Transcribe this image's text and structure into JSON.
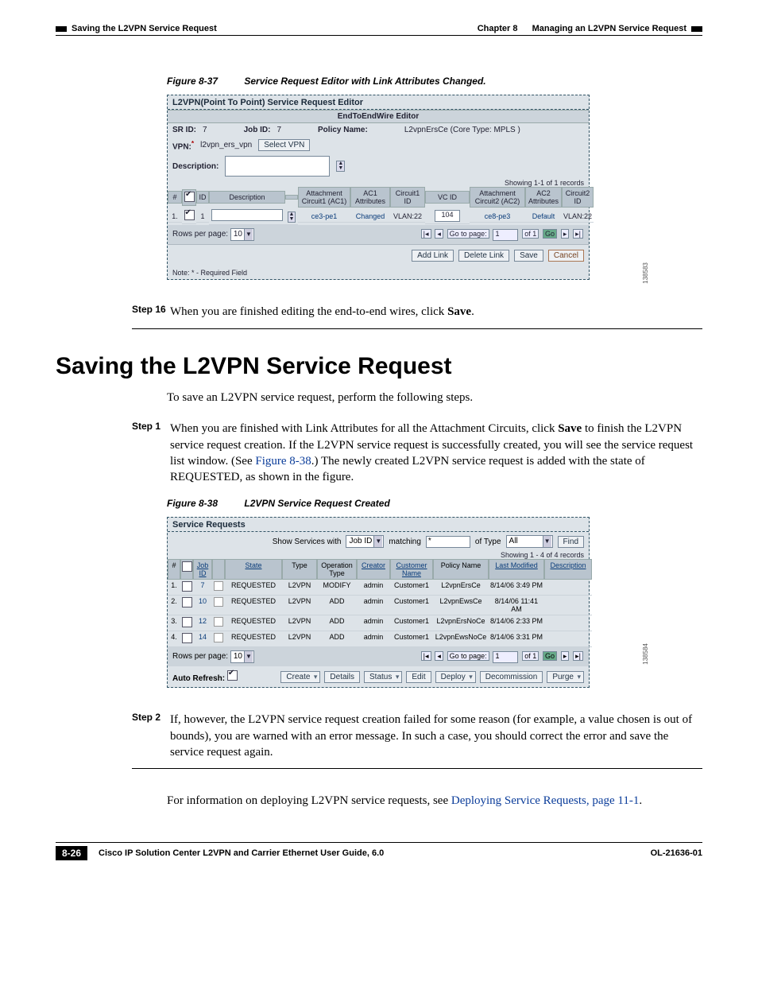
{
  "header": {
    "chapter_label": "Chapter 8",
    "chapter_title": "Managing an L2VPN Service Request",
    "section_title": "Saving the L2VPN Service Request"
  },
  "fig37": {
    "num": "Figure 8-37",
    "title": "Service Request Editor with Link Attributes Changed.",
    "window_title": "L2VPN(Point To Point) Service Request Editor",
    "sub": "EndToEndWire Editor",
    "labels": {
      "sr_id": "SR ID:",
      "job_id": "Job ID:",
      "policy_name": "Policy Name:",
      "vpn": "VPN:",
      "description": "Description:"
    },
    "values": {
      "sr_id": "7",
      "job_id": "7",
      "policy_name": "L2vpnErsCe (Core Type: MPLS )",
      "vpn": "l2vpn_ers_vpn"
    },
    "select_vpn_btn": "Select VPN",
    "records": "Showing 1-1 of 1 records",
    "cols": [
      "#",
      "",
      "ID",
      "Description",
      "",
      "Attachment Circuit1 (AC1)",
      "AC1 Attributes",
      "Circuit1 ID",
      "VC ID",
      "Attachment Circuit2 (AC2)",
      "AC2 Attributes",
      "Circuit2 ID"
    ],
    "row": {
      "n": "1.",
      "id": "1",
      "ac1": "ce3-pe1",
      "ac1attr": "Changed",
      "c1id": "VLAN:22",
      "vcid": "104",
      "ac2": "ce8-pe3",
      "ac2attr": "Default",
      "c2id": "VLAN:22"
    },
    "rows_per_page_label": "Rows per page:",
    "rows_per_page_value": "10",
    "goto_label": "Go to page:",
    "goto_value": "1",
    "of_label": "of 1",
    "go_btn": "Go",
    "buttons": {
      "add": "Add Link",
      "delete": "Delete Link",
      "save": "Save",
      "cancel": "Cancel"
    },
    "req_note": "Note: * - Required Field",
    "img_id": "138583"
  },
  "step16": {
    "label": "Step 16",
    "text_before": "When you are finished editing the end-to-end wires, click ",
    "bold": "Save",
    "after": "."
  },
  "section": {
    "heading": "Saving the L2VPN Service Request",
    "intro": "To save an L2VPN service request, perform the following steps."
  },
  "step1": {
    "label": "Step 1",
    "p1a": "When you are finished with Link Attributes for all the Attachment Circuits, click ",
    "p1b": "Save",
    "p1c": " to finish the L2VPN service request creation. If the L2VPN service request is successfully created, you will see the service request list window. (See ",
    "xref": "Figure 8-38",
    "p1d": ".) The newly created L2VPN service request is added with the state of REQUESTED, as shown in the figure."
  },
  "fig38": {
    "num": "Figure 8-38",
    "title": "L2VPN Service Request Created",
    "window_title": "Service Requests",
    "filter": {
      "show_label": "Show Services with",
      "field": "Job ID",
      "matching_label": "matching",
      "matching_value": "*",
      "of_type_label": "of Type",
      "of_type_value": "All",
      "find": "Find"
    },
    "records": "Showing 1 - 4 of 4 records",
    "cols": [
      "#",
      "",
      "Job ID",
      "",
      "State",
      "Type",
      "Operation Type",
      "Creator",
      "Customer Name",
      "Policy Name",
      "Last Modified",
      "Description"
    ],
    "rows": [
      {
        "n": "1.",
        "job": "7",
        "state": "REQUESTED",
        "type": "L2VPN",
        "op": "MODIFY",
        "creator": "admin",
        "cust": "Customer1",
        "policy": "L2vpnErsCe",
        "lm": "8/14/06 3:49 PM",
        "desc": ""
      },
      {
        "n": "2.",
        "job": "10",
        "state": "REQUESTED",
        "type": "L2VPN",
        "op": "ADD",
        "creator": "admin",
        "cust": "Customer1",
        "policy": "L2vpnEwsCe",
        "lm": "8/14/06 11:41 AM",
        "desc": ""
      },
      {
        "n": "3.",
        "job": "12",
        "state": "REQUESTED",
        "type": "L2VPN",
        "op": "ADD",
        "creator": "admin",
        "cust": "Customer1",
        "policy": "L2vpnErsNoCe",
        "lm": "8/14/06 2:33 PM",
        "desc": ""
      },
      {
        "n": "4.",
        "job": "14",
        "state": "REQUESTED",
        "type": "L2VPN",
        "op": "ADD",
        "creator": "admin",
        "cust": "Customer1",
        "policy": "L2vpnEwsNoCe",
        "lm": "8/14/06 3:31 PM",
        "desc": ""
      }
    ],
    "rows_per_page_label": "Rows per page:",
    "rows_per_page_value": "10",
    "goto_label": "Go to page:",
    "goto_value": "1",
    "of_label": "of 1",
    "go_btn": "Go",
    "auto_refresh": "Auto Refresh:",
    "buttons": [
      "Create",
      "Details",
      "Status",
      "Edit",
      "Deploy",
      "Decommission",
      "Purge"
    ],
    "img_id": "138584"
  },
  "step2": {
    "label": "Step 2",
    "text": "If, however, the L2VPN service request creation failed for some reason (for example, a value chosen is out of bounds), you are warned with an error message. In such a case, you should correct the error and save the service request again."
  },
  "closing": {
    "text_a": "For information on deploying L2VPN service requests, see ",
    "xref": "Deploying Service Requests, page 11-1",
    "text_b": "."
  },
  "footer": {
    "book": "Cisco IP Solution Center L2VPN and Carrier Ethernet User Guide, 6.0",
    "page": "8-26",
    "docid": "OL-21636-01"
  }
}
